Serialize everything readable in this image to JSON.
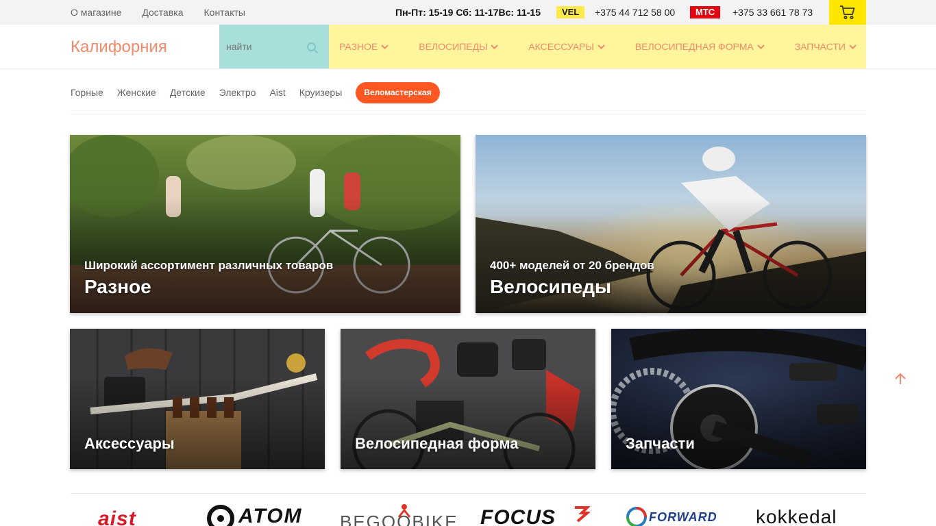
{
  "topbar": {
    "links": [
      "О магазине",
      "Доставка",
      "Контакты"
    ],
    "hours": "Пн-Пт: 15-19 Сб: 11-17Вс: 11-15",
    "operator1": "VEL",
    "phone1": "+375 44 712 58 00",
    "operator2": "МТС",
    "phone2": "+375 33 661 78 73",
    "cart_icon": "cart-icon"
  },
  "header": {
    "logo": "Калифорния",
    "search_placeholder": "найти",
    "menu": [
      "Разное",
      "Велосипеды",
      "Аксессуары",
      "Велосипедная форма",
      "Запчасти"
    ]
  },
  "subnav": {
    "items": [
      "Горные",
      "Женские",
      "Детские",
      "Электро",
      "Aist",
      "Круизеры"
    ],
    "highlight": "Веломастерская"
  },
  "cards": [
    {
      "subtitle": "Широкий ассортимент различных товаров",
      "title": "Разное"
    },
    {
      "subtitle": "400+ моделей от 20 брендов",
      "title": "Велосипеды"
    },
    {
      "title": "Аксессуары"
    },
    {
      "title": "Велосипедная форма"
    },
    {
      "title": "Запчасти"
    }
  ],
  "brands": [
    "aist",
    "ATOM",
    "BEGOOBIKE",
    "FOCUS",
    "FORWARD",
    "kokkedal"
  ],
  "colors": {
    "accent": "#f08a6a",
    "search_bg": "#a8dfda",
    "menu_bg": "#fff59d",
    "pill": "#ff5722",
    "cart_bg": "#ffe600"
  }
}
